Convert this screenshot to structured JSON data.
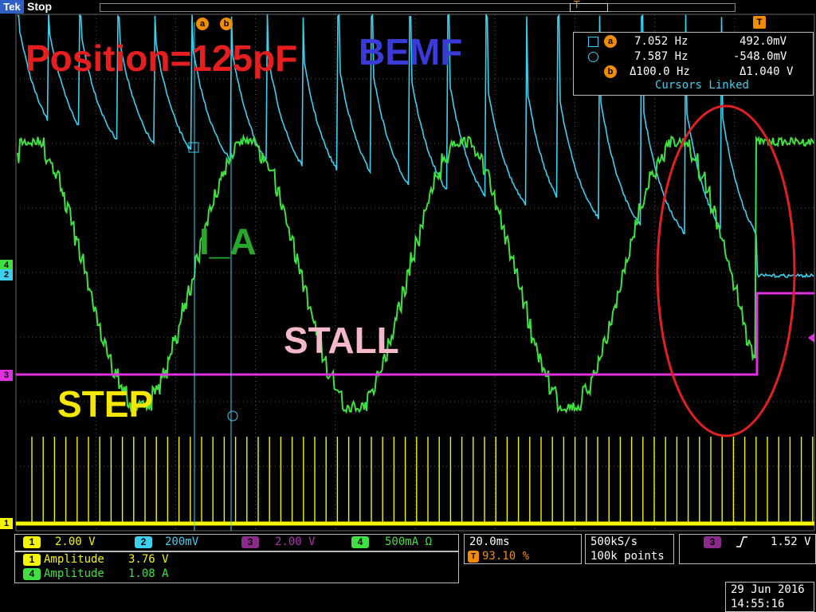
{
  "status": {
    "brand": "Tek",
    "run_state": "Stop"
  },
  "annotations": {
    "position": "Position=125pF",
    "bemf": "BEMF",
    "i_a": "I_A",
    "stall": "STALL",
    "step": "STEP"
  },
  "cursor_markers": {
    "a": "a",
    "b": "b",
    "trigger": "T"
  },
  "cursor_readout": {
    "row_a": {
      "freq": "7.052 Hz",
      "value": "492.0mV"
    },
    "row_2": {
      "freq": "7.587 Hz",
      "value": "-548.0mV"
    },
    "row_b": {
      "freq": "Δ100.0 Hz",
      "value": "Δ1.040 V"
    },
    "linked": "Cursors Linked"
  },
  "channels": [
    {
      "id": "1",
      "scale": "2.00 V",
      "color": "#f5f500"
    },
    {
      "id": "2",
      "scale": "200mV",
      "color": "#3cd0f0"
    },
    {
      "id": "3",
      "scale": "2.00 V",
      "color": "#e030e0"
    },
    {
      "id": "4",
      "scale": "500mA Ω",
      "color": "#40e040"
    }
  ],
  "measurements": [
    {
      "ch": "1",
      "name": "Amplitude",
      "value": "3.76 V"
    },
    {
      "ch": "4",
      "name": "Amplitude",
      "value": "1.08 A"
    }
  ],
  "timebase": {
    "scale": "20.0ms",
    "trig_pos_icon": "T",
    "trig_pos": "93.10 %"
  },
  "acquisition": {
    "rate": "500kS/s",
    "points": "100k points"
  },
  "trigger": {
    "ch": "3",
    "slope_icon": "rising-edge",
    "level": "1.52 V"
  },
  "datetime": {
    "date": "29 Jun  2016",
    "time": "14:55:16"
  },
  "colors": {
    "ch1": "#f5f500",
    "ch2": "#3cd0f0",
    "ch3": "#e030e0",
    "ch4": "#40e040",
    "cursor": "#f28c00",
    "tek_brand": "#2f5fc4",
    "ellipse": "#e02020"
  }
}
